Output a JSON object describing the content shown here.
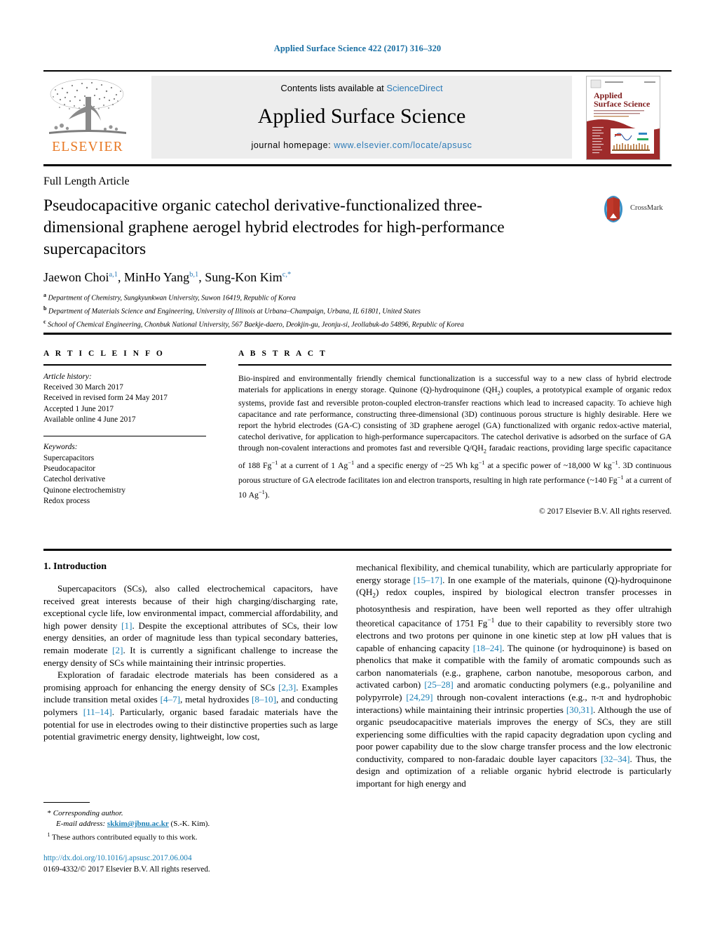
{
  "running_head": "Applied Surface Science 422 (2017) 316–320",
  "masthead": {
    "contents_prefix": "Contents lists available at ",
    "sciencedirect": "ScienceDirect",
    "journal_title": "Applied Surface Science",
    "homepage_prefix": "journal homepage: ",
    "homepage_url": "www.elsevier.com/locate/apsusc",
    "publisher": "ELSEVIER",
    "cover_title_line1": "Applied",
    "cover_title_line2": "Surface Science",
    "accent_color": "#e87722",
    "link_color": "#2e7cb8"
  },
  "article": {
    "type": "Full Length Article",
    "title": "Pseudocapacitive organic catechol derivative-functionalized three-dimensional graphene aerogel hybrid electrodes for high-performance supercapacitors",
    "crossmark_label": "CrossMark",
    "authors": [
      {
        "name": "Jaewon Choi",
        "marks": "a,1"
      },
      {
        "name": "MinHo Yang",
        "marks": "b,1"
      },
      {
        "name": "Sung-Kon Kim",
        "marks": "c,*"
      }
    ],
    "affiliations": [
      {
        "mark": "a",
        "text": "Department of Chemistry, Sungkyunkwan University, Suwon 16419, Republic of Korea"
      },
      {
        "mark": "b",
        "text": "Department of Materials Science and Engineering, University of Illinois at Urbana–Champaign, Urbana, IL 61801, United States"
      },
      {
        "mark": "c",
        "text": "School of Chemical Engineering, Chonbuk National University, 567 Baekje-daero, Deokjin-gu, Jeonju-si, Jeollabuk-do 54896, Republic of Korea"
      }
    ]
  },
  "article_info": {
    "heading": "A R T I C L E    I N F O",
    "history_label": "Article history:",
    "history": [
      "Received 30 March 2017",
      "Received in revised form 24 May 2017",
      "Accepted 1 June 2017",
      "Available online 4 June 2017"
    ],
    "keywords_label": "Keywords:",
    "keywords": [
      "Supercapacitors",
      "Pseudocapacitor",
      "Catechol derivative",
      "Quinone electrochemistry",
      "Redox process"
    ]
  },
  "abstract": {
    "heading": "A B S T R A C T",
    "copyright": "© 2017 Elsevier B.V. All rights reserved."
  },
  "introduction": {
    "heading": "1.  Introduction"
  },
  "footnotes": {
    "corresponding_marker": "*",
    "corresponding_text": "Corresponding author.",
    "email_label": "E-mail address:",
    "email": "skkim@jbnu.ac.kr",
    "email_owner": "(S.-K. Kim).",
    "equal_marker": "1",
    "equal_text": "These authors contributed equally to this work."
  },
  "footer": {
    "doi": "http://dx.doi.org/10.1016/j.apsusc.2017.06.004",
    "issn_line": "0169-4332/© 2017 Elsevier B.V. All rights reserved."
  }
}
